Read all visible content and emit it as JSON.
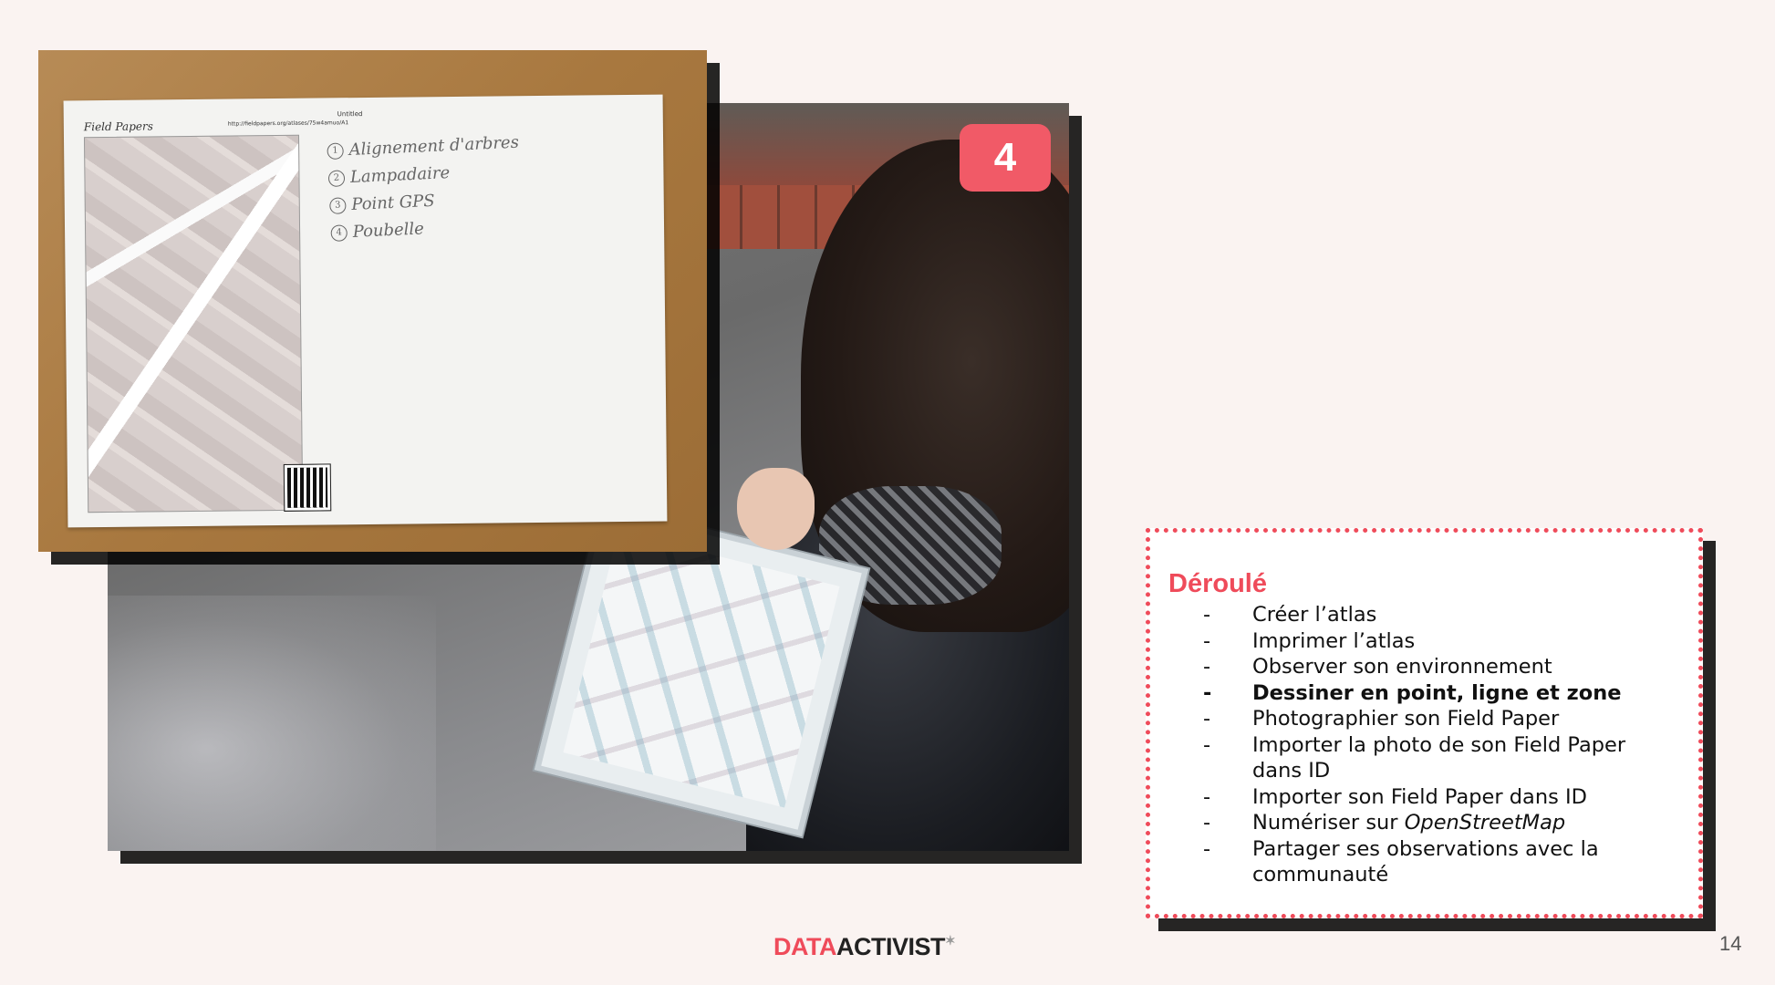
{
  "badge": {
    "number": "4",
    "color": "#f15a67"
  },
  "field_paper": {
    "title": "Field Papers",
    "untitled": "Untitled",
    "url": "http://fieldpapers.org/atlases/75w4amuo/A1",
    "legend": [
      {
        "num": "1",
        "text": "Alignement d'arbres"
      },
      {
        "num": "2",
        "text": "Lampadaire"
      },
      {
        "num": "3",
        "text": "Point GPS"
      },
      {
        "num": "4",
        "text": "Poubelle"
      }
    ]
  },
  "steps": {
    "title": "Déroulé",
    "accent": "#ef4b5a",
    "items": [
      {
        "text": "Créer l’atlas",
        "bold": false
      },
      {
        "text": "Imprimer l’atlas",
        "bold": false
      },
      {
        "text": "Observer son environnement",
        "bold": false
      },
      {
        "text": "Dessiner en point, ligne et zone",
        "bold": true
      },
      {
        "text": "Photographier son Field Paper",
        "bold": false
      },
      {
        "text": "Importer la photo de son Field Paper dans ID",
        "bold": false
      },
      {
        "text": "Importer son Field Paper dans ID",
        "bold": false
      },
      {
        "text_before": "Numériser sur ",
        "text_italic": "OpenStreetMap",
        "bold": false
      },
      {
        "text": "Partager ses observations avec la communauté",
        "bold": false
      }
    ]
  },
  "logo": {
    "part1": "DATA",
    "part2": "ACTIVIST"
  },
  "page_number": "14"
}
